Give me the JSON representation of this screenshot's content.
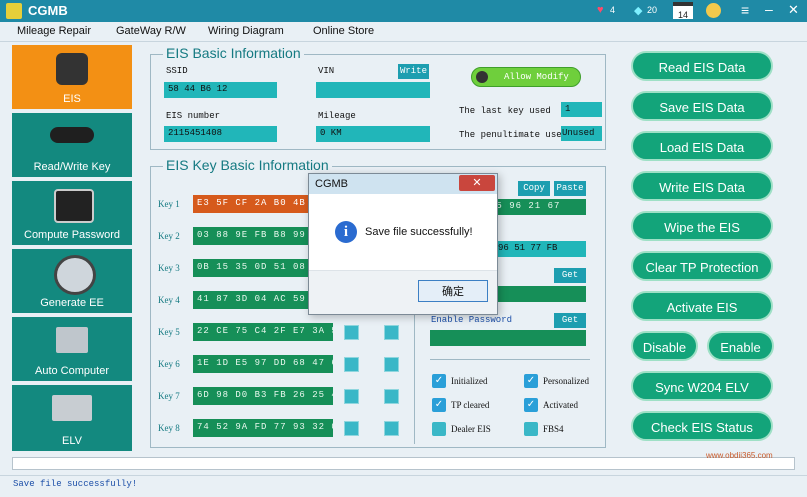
{
  "app": {
    "title": "CGMB"
  },
  "status_icons": {
    "hearts": "4",
    "diamonds": "20",
    "date": "14"
  },
  "menu": [
    "Mileage Repair",
    "GateWay R/W",
    "Wiring Diagram",
    "Online Store"
  ],
  "sidebar": [
    {
      "label": "EIS",
      "icon": "key-icon",
      "active": true
    },
    {
      "label": "Read/Write Key",
      "icon": "car-key-icon",
      "active": false
    },
    {
      "label": "Compute Password",
      "icon": "laptop-icon",
      "active": false
    },
    {
      "label": "Generate EE",
      "icon": "printer-icon",
      "active": false
    },
    {
      "label": "Auto Computer",
      "icon": "ecu-icon",
      "active": false
    },
    {
      "label": "ELV",
      "icon": "circuit-board-icon",
      "active": false
    }
  ],
  "basic": {
    "title": "EIS Basic Information",
    "ssid_label": "SSID",
    "ssid_value": "58 44 B6 12",
    "vin_label": "VIN",
    "vin_value": "",
    "write_label": "Write",
    "allow_modify": "Allow Modify",
    "eis_number_label": "EIS number",
    "eis_number_value": "2115451408",
    "mileage_label": "Mileage",
    "mileage_value": "0 KM",
    "last_key_label": "The last key used",
    "last_key_value": "1",
    "penultimate_label": "The penultimate used",
    "penultimate_value": "Unused"
  },
  "keys": {
    "title": "EIS Key Basic Information",
    "copy_label": "Copy",
    "paste_label": "Paste",
    "rows": [
      {
        "label": "Key 1",
        "value": "E3 5F CF 2A B0 4B 4B"
      },
      {
        "label": "Key 2",
        "value": "03 88 9E FB B8 99 58"
      },
      {
        "label": "Key 3",
        "value": "0B 15 35 0D 51 08 E4"
      },
      {
        "label": "Key 4",
        "value": "41 87 3D 04 AC 59 39"
      },
      {
        "label": "Key 5",
        "value": "22 CE 75 C4 2F E7 3A 59"
      },
      {
        "label": "Key 6",
        "value": "1E 1D E5 97 DD 68 47 6A"
      },
      {
        "label": "Key 7",
        "value": "6D 98 D0 B3 FB 26 25 46"
      },
      {
        "label": "Key 8",
        "value": "74 52 9A FD 77 93 32 05"
      }
    ],
    "right_field1": "A5 96 21 67",
    "right_field2": "96 51 77 FB",
    "get_label": "Get",
    "enable_password_label": "Enable Password",
    "checkboxes": [
      {
        "label": "Initialized",
        "checked": true
      },
      {
        "label": "Personalized",
        "checked": true
      },
      {
        "label": "TP cleared",
        "checked": true
      },
      {
        "label": "Activated",
        "checked": true
      },
      {
        "label": "Dealer EIS",
        "checked": false
      },
      {
        "label": "FBS4",
        "checked": false
      }
    ]
  },
  "actions": {
    "read": "Read  EIS Data",
    "save": "Save EIS Data",
    "load": "Load EIS Data",
    "write": "Write EIS Data",
    "wipe": "Wipe the EIS",
    "clear_tp": "Clear TP Protection",
    "activate": "Activate EIS",
    "disable": "Disable",
    "enable": "Enable",
    "sync": "Sync W204 ELV",
    "check": "Check EIS Status"
  },
  "dialog": {
    "title": "CGMB",
    "message": "Save file successfully!",
    "ok": "确定",
    "icon": "info-icon"
  },
  "status": {
    "text": "Save file successfully!"
  },
  "watermark": "www.obdii365.com"
}
